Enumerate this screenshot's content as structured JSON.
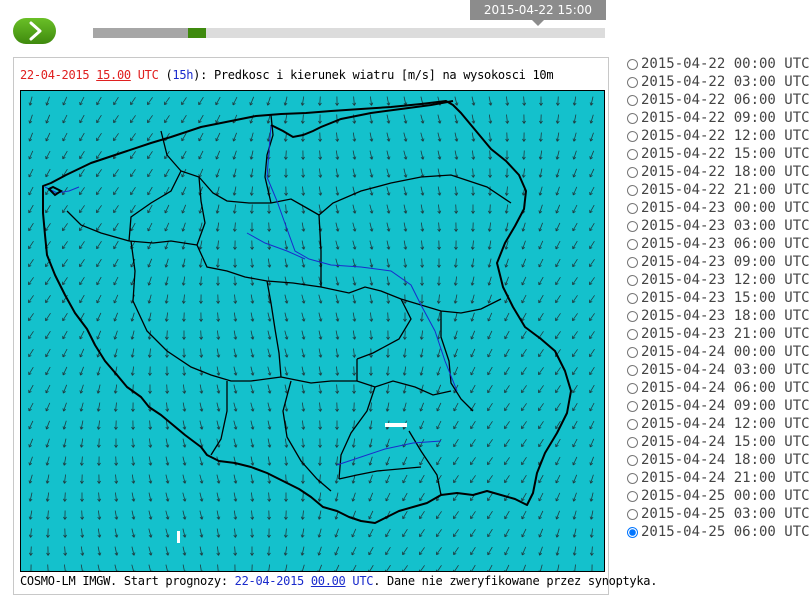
{
  "player": {
    "play_icon": "chevron-right-icon",
    "current_time": "2015-04-22 15:00",
    "progress_fraction": 0.185
  },
  "map": {
    "title_date": "22-04-2015",
    "title_hour": "15.00",
    "title_utc": "UTC",
    "title_paren_open": " (",
    "title_lead": "15h",
    "title_paren_close": "): ",
    "title_text": "Predkosc i kierunek wiatru [m/s] na wysokosci 10m",
    "footer_prefix": "COSMO-LM IMGW. Start prognozy: ",
    "footer_date": "22-04-2015",
    "footer_hour": "00.00",
    "footer_utc": "UTC",
    "footer_suffix": ". Dane nie zweryfikowane przez synoptyka.",
    "colors": {
      "background": "#14c1cc",
      "border": "#000000",
      "river": "#1a2bcc"
    }
  },
  "times": [
    "2015-04-22 00:00 UTC",
    "2015-04-22 03:00 UTC",
    "2015-04-22 06:00 UTC",
    "2015-04-22 09:00 UTC",
    "2015-04-22 12:00 UTC",
    "2015-04-22 15:00 UTC",
    "2015-04-22 18:00 UTC",
    "2015-04-22 21:00 UTC",
    "2015-04-23 00:00 UTC",
    "2015-04-23 03:00 UTC",
    "2015-04-23 06:00 UTC",
    "2015-04-23 09:00 UTC",
    "2015-04-23 12:00 UTC",
    "2015-04-23 15:00 UTC",
    "2015-04-23 18:00 UTC",
    "2015-04-23 21:00 UTC",
    "2015-04-24 00:00 UTC",
    "2015-04-24 03:00 UTC",
    "2015-04-24 06:00 UTC",
    "2015-04-24 09:00 UTC",
    "2015-04-24 12:00 UTC",
    "2015-04-24 15:00 UTC",
    "2015-04-24 18:00 UTC",
    "2015-04-24 21:00 UTC",
    "2015-04-25 00:00 UTC",
    "2015-04-25 03:00 UTC",
    "2015-04-25 06:00 UTC"
  ],
  "selected_index": 26
}
